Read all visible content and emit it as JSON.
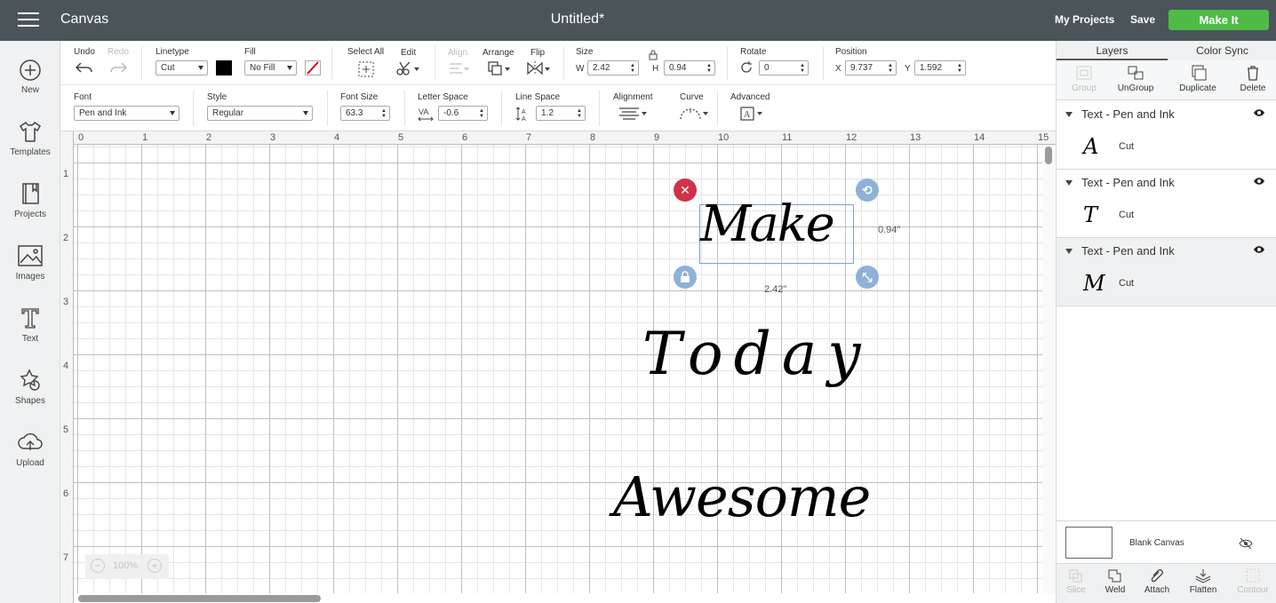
{
  "app": {
    "name": "Canvas",
    "document_title": "Untitled*"
  },
  "header": {
    "my_projects": "My Projects",
    "save": "Save",
    "make_it": "Make It",
    "make_it_color": "#4fbb47"
  },
  "sidebar": {
    "items": [
      {
        "label": "New",
        "icon": "plus-circle-icon"
      },
      {
        "label": "Templates",
        "icon": "tshirt-icon"
      },
      {
        "label": "Projects",
        "icon": "notebook-icon"
      },
      {
        "label": "Images",
        "icon": "image-icon"
      },
      {
        "label": "Text",
        "icon": "text-t-icon"
      },
      {
        "label": "Shapes",
        "icon": "shapes-icon"
      },
      {
        "label": "Upload",
        "icon": "upload-cloud-icon"
      }
    ]
  },
  "toolbar": {
    "undo": "Undo",
    "redo": "Redo",
    "linetype_label": "Linetype",
    "linetype_value": "Cut",
    "fill_label": "Fill",
    "fill_value": "No Fill",
    "select_all": "Select All",
    "edit": "Edit",
    "align": "Align",
    "arrange": "Arrange",
    "flip": "Flip",
    "size_label": "Size",
    "w_label": "W",
    "w_value": "2.42",
    "h_label": "H",
    "h_value": "0.94",
    "rotate_label": "Rotate",
    "rotate_value": "0",
    "position_label": "Position",
    "x_label": "X",
    "x_value": "9.737",
    "y_label": "Y",
    "y_value": "1.592"
  },
  "text_toolbar": {
    "font_label": "Font",
    "font_value": "Pen and Ink",
    "style_label": "Style",
    "style_value": "Regular",
    "font_size_label": "Font Size",
    "font_size_value": "63.3",
    "letter_space_label": "Letter Space",
    "letter_space_value": "-0.6",
    "line_space_label": "Line Space",
    "line_space_value": "1.2",
    "alignment_label": "Alignment",
    "curve_label": "Curve",
    "advanced_label": "Advanced"
  },
  "canvas": {
    "ruler_top": [
      "0",
      "1",
      "2",
      "3",
      "4",
      "5",
      "6",
      "7",
      "8",
      "9",
      "10",
      "11",
      "12",
      "13",
      "14",
      "15"
    ],
    "ruler_left": [
      "1",
      "2",
      "3",
      "4",
      "5",
      "6",
      "7"
    ],
    "zoom": "100%",
    "width_dim": "2.42\"",
    "height_dim": "0.94\"",
    "text_lines": [
      "Make",
      "Today",
      "Awesome"
    ]
  },
  "layers_panel": {
    "tab_layers": "Layers",
    "tab_color_sync": "Color Sync",
    "actions": [
      {
        "label": "Group",
        "enabled": false
      },
      {
        "label": "UnGroup",
        "enabled": true
      },
      {
        "label": "Duplicate",
        "enabled": true
      },
      {
        "label": "Delete",
        "enabled": true
      }
    ],
    "layers": [
      {
        "title": "Text - Pen and Ink",
        "glyph": "A",
        "operation": "Cut"
      },
      {
        "title": "Text - Pen and Ink",
        "glyph": "T",
        "operation": "Cut"
      },
      {
        "title": "Text - Pen and Ink",
        "glyph": "M",
        "operation": "Cut"
      }
    ],
    "blank_canvas": "Blank Canvas",
    "bottom_actions": [
      {
        "label": "Slice",
        "enabled": false
      },
      {
        "label": "Weld",
        "enabled": true
      },
      {
        "label": "Attach",
        "enabled": true
      },
      {
        "label": "Flatten",
        "enabled": true
      },
      {
        "label": "Contour",
        "enabled": false
      }
    ]
  }
}
